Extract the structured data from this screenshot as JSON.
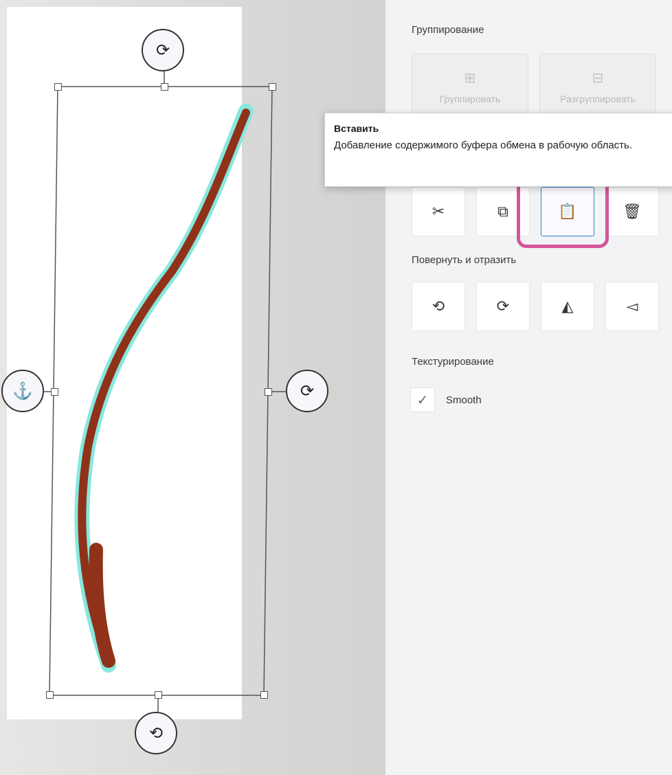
{
  "panel": {
    "grouping_label": "Группирование",
    "group_button": "Группировать",
    "ungroup_button": "Разгруппировать",
    "rotate_flip_label": "Повернуть и отразить",
    "texturing_label": "Текстурирование",
    "smooth_label": "Smooth",
    "smooth_checked": "✓"
  },
  "tooltip": {
    "title": "Вставить",
    "description": "Добавление содержимого буфера обмена в рабочую область."
  },
  "icons": {
    "cut": "✂",
    "copy": "⧉",
    "paste": "📋",
    "delete": "🗑",
    "rotate_left": "⟲",
    "rotate_right": "⟳",
    "flip_horizontal": "◭",
    "flip_vertical": "◅",
    "group": "⊞",
    "ungroup": "⊟"
  },
  "colors": {
    "accent": "#d4569a",
    "selection": "#3a7bd5",
    "stroke": "#8f3219",
    "glow": "#7fe6de"
  }
}
